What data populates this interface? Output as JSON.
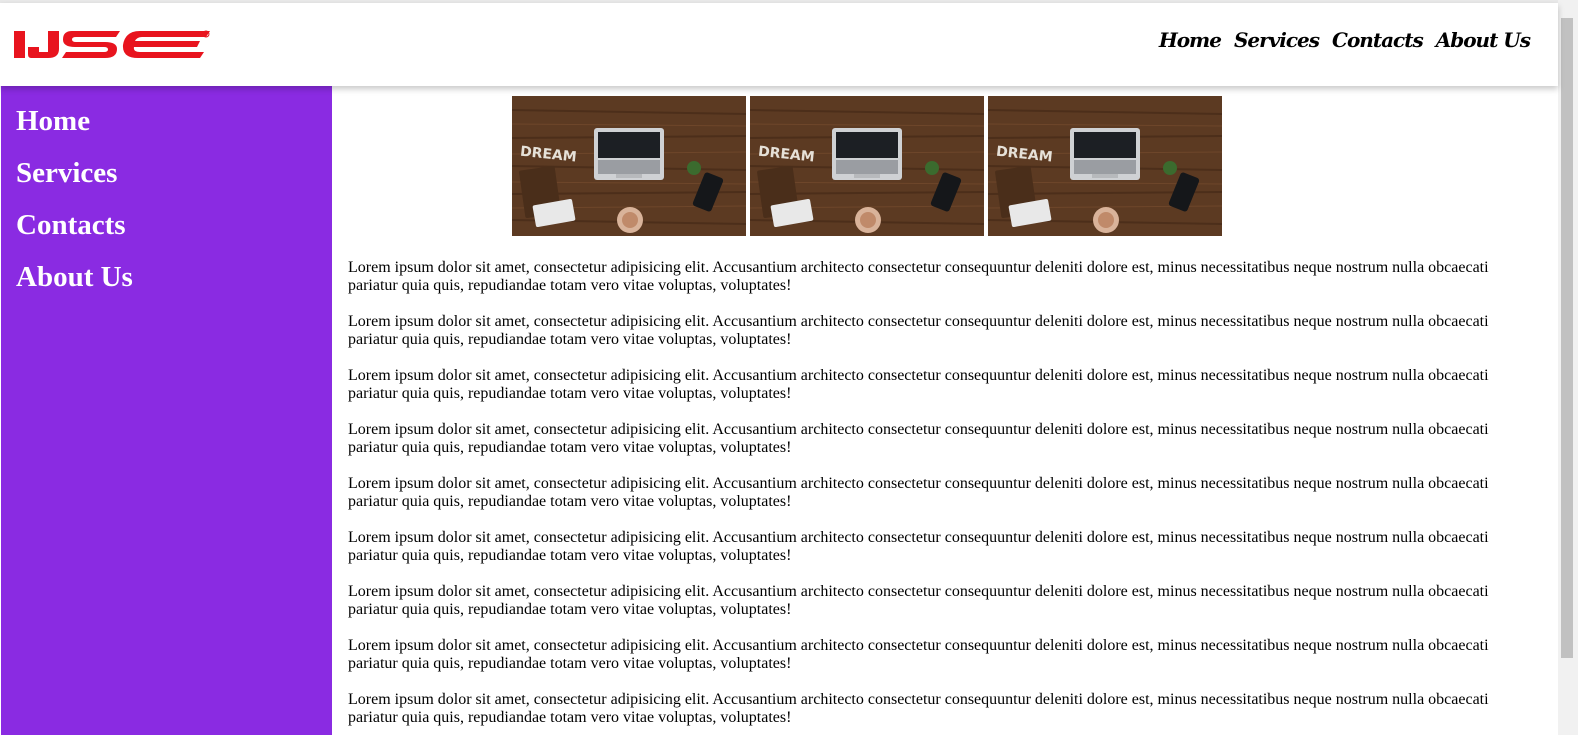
{
  "logo": {
    "text": "IJSE",
    "color": "#e8141e"
  },
  "top_nav": {
    "items": [
      {
        "label": "Home"
      },
      {
        "label": "Services"
      },
      {
        "label": "Contacts"
      },
      {
        "label": "About Us"
      }
    ]
  },
  "sidebar": {
    "color": "#8a2be2",
    "items": [
      {
        "label": "Home"
      },
      {
        "label": "Services"
      },
      {
        "label": "Contacts"
      },
      {
        "label": "About Us"
      }
    ]
  },
  "gallery": {
    "images": [
      {
        "sign_text": "DREAM"
      },
      {
        "sign_text": "DREAM"
      },
      {
        "sign_text": "DREAM"
      }
    ]
  },
  "paragraphs": [
    "Lorem ipsum dolor sit amet, consectetur adipisicing elit. Accusantium architecto consectetur consequuntur deleniti dolore est, minus necessitatibus neque nostrum nulla obcaecati pariatur quia quis, repudiandae totam vero vitae voluptas, voluptates!",
    "Lorem ipsum dolor sit amet, consectetur adipisicing elit. Accusantium architecto consectetur consequuntur deleniti dolore est, minus necessitatibus neque nostrum nulla obcaecati pariatur quia quis, repudiandae totam vero vitae voluptas, voluptates!",
    "Lorem ipsum dolor sit amet, consectetur adipisicing elit. Accusantium architecto consectetur consequuntur deleniti dolore est, minus necessitatibus neque nostrum nulla obcaecati pariatur quia quis, repudiandae totam vero vitae voluptas, voluptates!",
    "Lorem ipsum dolor sit amet, consectetur adipisicing elit. Accusantium architecto consectetur consequuntur deleniti dolore est, minus necessitatibus neque nostrum nulla obcaecati pariatur quia quis, repudiandae totam vero vitae voluptas, voluptates!",
    "Lorem ipsum dolor sit amet, consectetur adipisicing elit. Accusantium architecto consectetur consequuntur deleniti dolore est, minus necessitatibus neque nostrum nulla obcaecati pariatur quia quis, repudiandae totam vero vitae voluptas, voluptates!",
    "Lorem ipsum dolor sit amet, consectetur adipisicing elit. Accusantium architecto consectetur consequuntur deleniti dolore est, minus necessitatibus neque nostrum nulla obcaecati pariatur quia quis, repudiandae totam vero vitae voluptas, voluptates!",
    "Lorem ipsum dolor sit amet, consectetur adipisicing elit. Accusantium architecto consectetur consequuntur deleniti dolore est, minus necessitatibus neque nostrum nulla obcaecati pariatur quia quis, repudiandae totam vero vitae voluptas, voluptates!",
    "Lorem ipsum dolor sit amet, consectetur adipisicing elit. Accusantium architecto consectetur consequuntur deleniti dolore est, minus necessitatibus neque nostrum nulla obcaecati pariatur quia quis, repudiandae totam vero vitae voluptas, voluptates!",
    "Lorem ipsum dolor sit amet, consectetur adipisicing elit. Accusantium architecto consectetur consequuntur deleniti dolore est, minus necessitatibus neque nostrum nulla obcaecati pariatur quia quis, repudiandae totam vero vitae voluptas, voluptates!"
  ]
}
